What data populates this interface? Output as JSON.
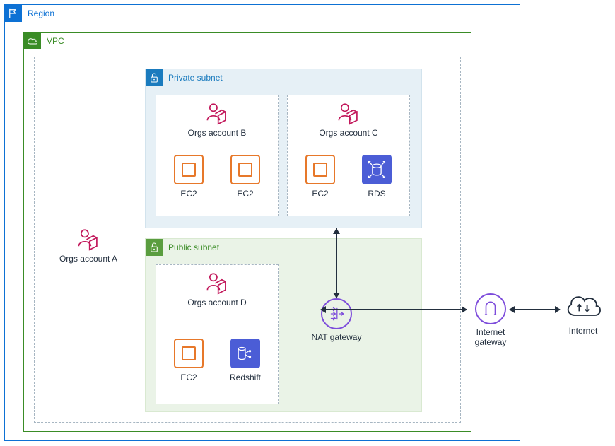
{
  "region": {
    "label": "Region"
  },
  "vpc": {
    "label": "VPC"
  },
  "private_subnet": {
    "label": "Private subnet"
  },
  "public_subnet": {
    "label": "Public subnet"
  },
  "accounts": {
    "a": {
      "label": "Orgs account A"
    },
    "b": {
      "label": "Orgs account B"
    },
    "c": {
      "label": "Orgs account C"
    },
    "d": {
      "label": "Orgs account D"
    }
  },
  "services": {
    "ec2": "EC2",
    "rds": "RDS",
    "redshift": "Redshift"
  },
  "nodes": {
    "nat": "NAT gateway",
    "igw": "Internet\ngateway",
    "internet": "Internet"
  },
  "connections": [
    {
      "from": "private_subnet",
      "to": "nat_gateway",
      "bidirectional": true
    },
    {
      "from": "nat_gateway",
      "to": "internet_gateway",
      "bidirectional": true
    },
    {
      "from": "internet_gateway",
      "to": "internet",
      "bidirectional": true
    }
  ]
}
